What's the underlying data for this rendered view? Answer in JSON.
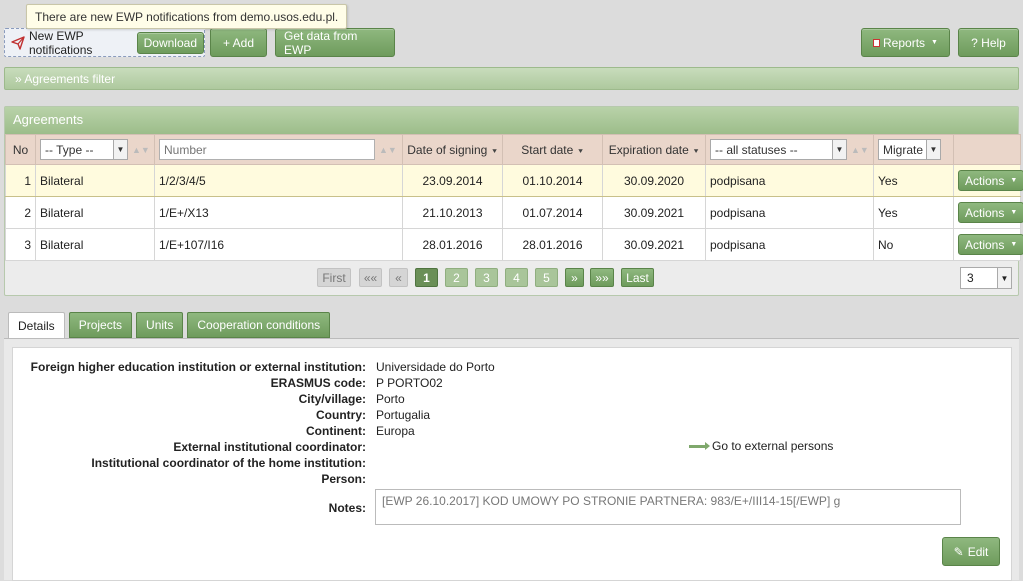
{
  "tooltip": "There are new EWP notifications from demo.usos.edu.pl.",
  "toolbar": {
    "notifications_label": "New EWP notifications",
    "download_label": "Download",
    "add_label": "+ Add",
    "get_data_label": "Get data from EWP",
    "reports_label": "Reports",
    "help_label": "? Help"
  },
  "filter_label": "Agreements filter",
  "agreements": {
    "title": "Agreements",
    "columns": {
      "no": "No",
      "type_filter": "-- Type --",
      "number_placeholder": "Number",
      "date_signing": "Date of signing",
      "start_date": "Start date",
      "expiration_date": "Expiration date",
      "status_filter": "-- all statuses --",
      "migrate_filter": "Migrate"
    },
    "rows": [
      {
        "no": "1",
        "type": "Bilateral",
        "number": "1/2/3/4/5",
        "signing": "23.09.2014",
        "start": "01.10.2014",
        "expiration": "30.09.2020",
        "status": "podpisana",
        "migrate": "Yes",
        "action": "Actions"
      },
      {
        "no": "2",
        "type": "Bilateral",
        "number": "1/E+/X13",
        "signing": "21.10.2013",
        "start": "01.07.2014",
        "expiration": "30.09.2021",
        "status": "podpisana",
        "migrate": "Yes",
        "action": "Actions"
      },
      {
        "no": "3",
        "type": "Bilateral",
        "number": "1/E+107/I16",
        "signing": "28.01.2016",
        "start": "28.01.2016",
        "expiration": "30.09.2021",
        "status": "podpisana",
        "migrate": "No",
        "action": "Actions"
      }
    ],
    "pager": {
      "first": "First",
      "first_arrows": "««",
      "prev": "«",
      "pages": [
        "1",
        "2",
        "3",
        "4",
        "5"
      ],
      "next": "»",
      "last_arrows": "»»",
      "last": "Last",
      "per_page": "3"
    }
  },
  "tabs": [
    "Details",
    "Projects",
    "Units",
    "Cooperation conditions"
  ],
  "details": {
    "institution_label": "Foreign higher education institution or external institution:",
    "institution_value": "Universidade do Porto",
    "erasmus_label": "ERASMUS code:",
    "erasmus_value": "P PORTO02",
    "city_label": "City/village:",
    "city_value": "Porto",
    "country_label": "Country:",
    "country_value": "Portugalia",
    "continent_label": "Continent:",
    "continent_value": "Europa",
    "ext_coord_label": "External institutional coordinator:",
    "home_coord_label": "Institutional coordinator of the home institution:",
    "person_label": "Person:",
    "goto_label": "Go to external persons",
    "notes_label": "Notes:",
    "notes_value": "[EWP 26.10.2017] KOD UMOWY PO STRONIE PARTNERA: 983/E+/III14-15[/EWP] g",
    "edit_label": "Edit"
  }
}
